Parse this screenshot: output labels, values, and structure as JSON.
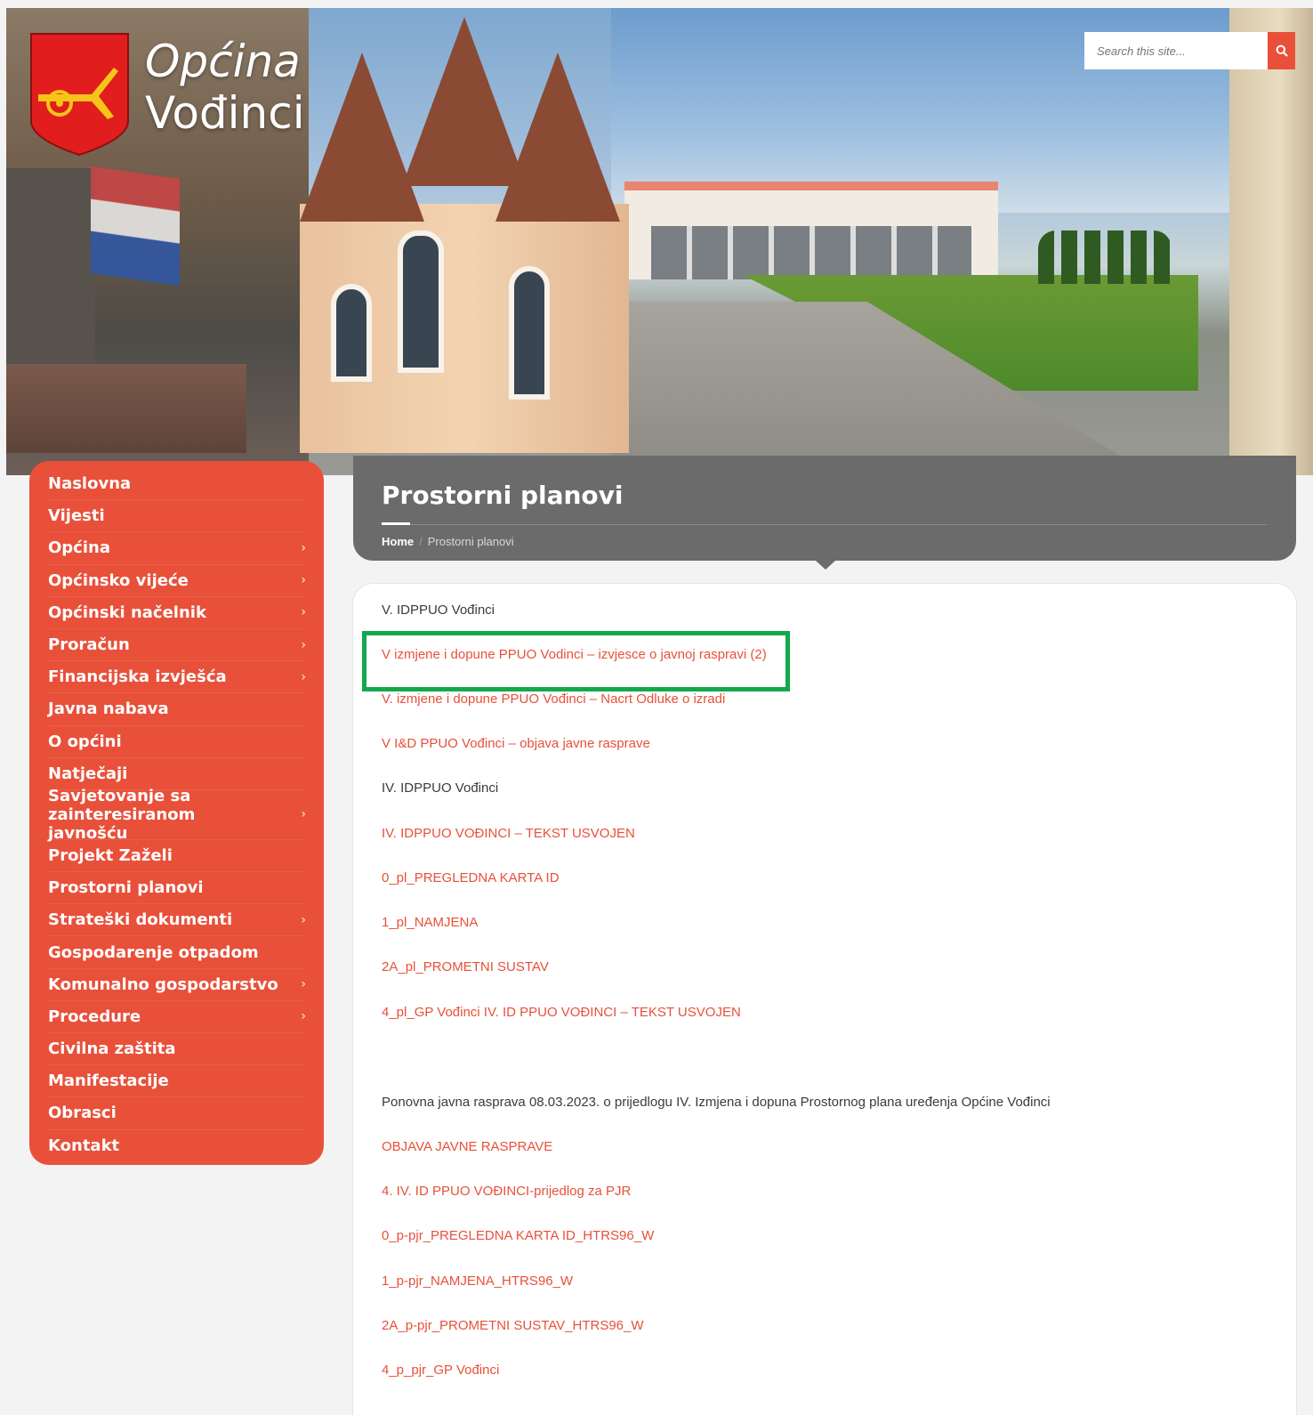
{
  "site": {
    "title_line1": "Općina",
    "title_line2": "Vođinci"
  },
  "search": {
    "placeholder": "Search this site..."
  },
  "sidebar": {
    "items": [
      {
        "label": "Naslovna",
        "has_submenu": false
      },
      {
        "label": "Vijesti",
        "has_submenu": false
      },
      {
        "label": "Općina",
        "has_submenu": true
      },
      {
        "label": "Općinsko vijeće",
        "has_submenu": true
      },
      {
        "label": "Općinski načelnik",
        "has_submenu": true
      },
      {
        "label": "Proračun",
        "has_submenu": true
      },
      {
        "label": "Financijska izvješća",
        "has_submenu": true
      },
      {
        "label": "Javna nabava",
        "has_submenu": false
      },
      {
        "label": "O općini",
        "has_submenu": false
      },
      {
        "label": "Natječaji",
        "has_submenu": false
      },
      {
        "label": "Savjetovanje sa zainteresiranom javnošću",
        "has_submenu": true
      },
      {
        "label": "Projekt Zaželi",
        "has_submenu": false
      },
      {
        "label": "Prostorni planovi",
        "has_submenu": false
      },
      {
        "label": "Strateški dokumenti",
        "has_submenu": true
      },
      {
        "label": "Gospodarenje otpadom",
        "has_submenu": false
      },
      {
        "label": "Komunalno gospodarstvo",
        "has_submenu": true
      },
      {
        "label": "Procedure",
        "has_submenu": true
      },
      {
        "label": "Civilna zaštita",
        "has_submenu": false
      },
      {
        "label": "Manifestacije",
        "has_submenu": false
      },
      {
        "label": "Obrasci",
        "has_submenu": false
      },
      {
        "label": "Kontakt",
        "has_submenu": false
      }
    ],
    "chevron": "›"
  },
  "header": {
    "page_title": "Prostorni planovi",
    "breadcrumb_home": "Home",
    "breadcrumb_sep": "/",
    "breadcrumb_current": "Prostorni planovi"
  },
  "content": {
    "entries": [
      {
        "type": "text",
        "label": "V. IDPPUO Vođinci"
      },
      {
        "type": "link",
        "label": "V izmjene i dopune PPUO Vodinci – izvjesce o javnoj raspravi (2)"
      },
      {
        "type": "link",
        "label": "V. izmjene i dopune PPUO Vođinci – Nacrt Odluke o izradi"
      },
      {
        "type": "link",
        "label": "V I&D PPUO Vođinci – objava javne rasprave"
      },
      {
        "type": "text",
        "label": "IV. IDPPUO Vođinci"
      },
      {
        "type": "link",
        "label": "IV. IDPPUO VOĐINCI – TEKST USVOJEN"
      },
      {
        "type": "link",
        "label": "0_pl_PREGLEDNA KARTA ID"
      },
      {
        "type": "link",
        "label": "1_pl_NAMJENA"
      },
      {
        "type": "link",
        "label": "2A_pl_PROMETNI SUSTAV"
      },
      {
        "type": "link",
        "label": "4_pl_GP Vođinci IV. ID PPUO VOĐINCI – TEKST USVOJEN"
      },
      {
        "type": "text",
        "label": "Ponovna javna rasprava 08.03.2023. o prijedlogu IV. Izmjena i dopuna Prostornog plana uređenja Općine Vođinci"
      },
      {
        "type": "link",
        "label": "OBJAVA JAVNE RASPRAVE"
      },
      {
        "type": "link",
        "label": "4. IV. ID PPUO VOĐINCI-prijedlog za PJR"
      },
      {
        "type": "link",
        "label": "0_p-pjr_PREGLEDNA KARTA ID_HTRS96_W"
      },
      {
        "type": "link",
        "label": "1_p-pjr_NAMJENA_HTRS96_W"
      },
      {
        "type": "link",
        "label": "2A_p-pjr_PROMETNI SUSTAV_HTRS96_W"
      },
      {
        "type": "link",
        "label": "4_p_pjr_GP Vođinci"
      }
    ],
    "highlighted_index": 1
  },
  "colors": {
    "accent": "#e8503a",
    "title_bar": "#6b6b6b",
    "highlight": "#12a84b"
  }
}
